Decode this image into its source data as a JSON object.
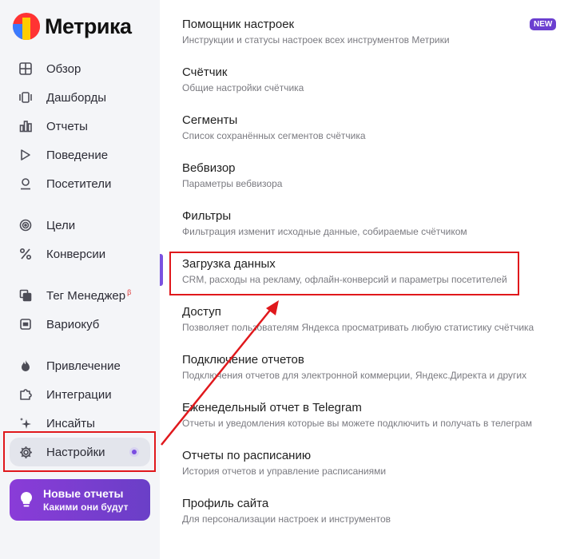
{
  "brand": {
    "name": "Метрика"
  },
  "sidebar": {
    "items": [
      {
        "label": "Обзор",
        "icon": "grid-icon"
      },
      {
        "label": "Дашборды",
        "icon": "dashboard-icon"
      },
      {
        "label": "Отчеты",
        "icon": "bar-chart-icon"
      },
      {
        "label": "Поведение",
        "icon": "play-icon"
      },
      {
        "label": "Посетители",
        "icon": "user-icon"
      },
      {
        "label": "Цели",
        "icon": "target-icon"
      },
      {
        "label": "Конверсии",
        "icon": "percent-icon"
      },
      {
        "label": "Тег Менеджер",
        "icon": "layers-icon",
        "sup": "β"
      },
      {
        "label": "Вариокуб",
        "icon": "cube-icon"
      },
      {
        "label": "Привлечение",
        "icon": "flame-icon"
      },
      {
        "label": "Интеграции",
        "icon": "puzzle-icon"
      },
      {
        "label": "Инсайты",
        "icon": "sparkle-icon"
      },
      {
        "label": "Настройки",
        "icon": "gear-icon",
        "active": true
      }
    ],
    "promo": {
      "title": "Новые отчеты",
      "subtitle": "Какими они будут",
      "icon": "lightbulb-icon"
    }
  },
  "main": {
    "items": [
      {
        "title": "Помощник настроек",
        "desc": "Инструкции и статусы настроек всех инструментов Метрики",
        "badge": "NEW"
      },
      {
        "title": "Счётчик",
        "desc": "Общие настройки счётчика"
      },
      {
        "title": "Сегменты",
        "desc": "Список сохранённых сегментов счётчика"
      },
      {
        "title": "Вебвизор",
        "desc": "Параметры вебвизора"
      },
      {
        "title": "Фильтры",
        "desc": "Фильтрация изменит исходные данные, собираемые счётчиком"
      },
      {
        "title": "Загрузка данных",
        "desc": "CRM, расходы на рекламу, офлайн-конверсий и параметры посетителей",
        "active": true
      },
      {
        "title": "Доступ",
        "desc": "Позволяет пользователям Яндекса просматривать любую статистику счётчика"
      },
      {
        "title": "Подключение отчетов",
        "desc": "Подключения отчетов для электронной коммерции, Яндекс.Директа и других"
      },
      {
        "title": "Еженедельный отчет в Telegram",
        "desc": "Отчеты и уведомления которые вы можете подключить и получать в телеграм"
      },
      {
        "title": "Отчеты по расписанию",
        "desc": "История отчетов и управление расписаниями"
      },
      {
        "title": "Профиль сайта",
        "desc": "Для персонализации настроек и инструментов"
      }
    ]
  },
  "colors": {
    "accent": "#6b3fd0",
    "annotation": "#e0181c",
    "sidebar_bg": "#f4f5f8"
  }
}
